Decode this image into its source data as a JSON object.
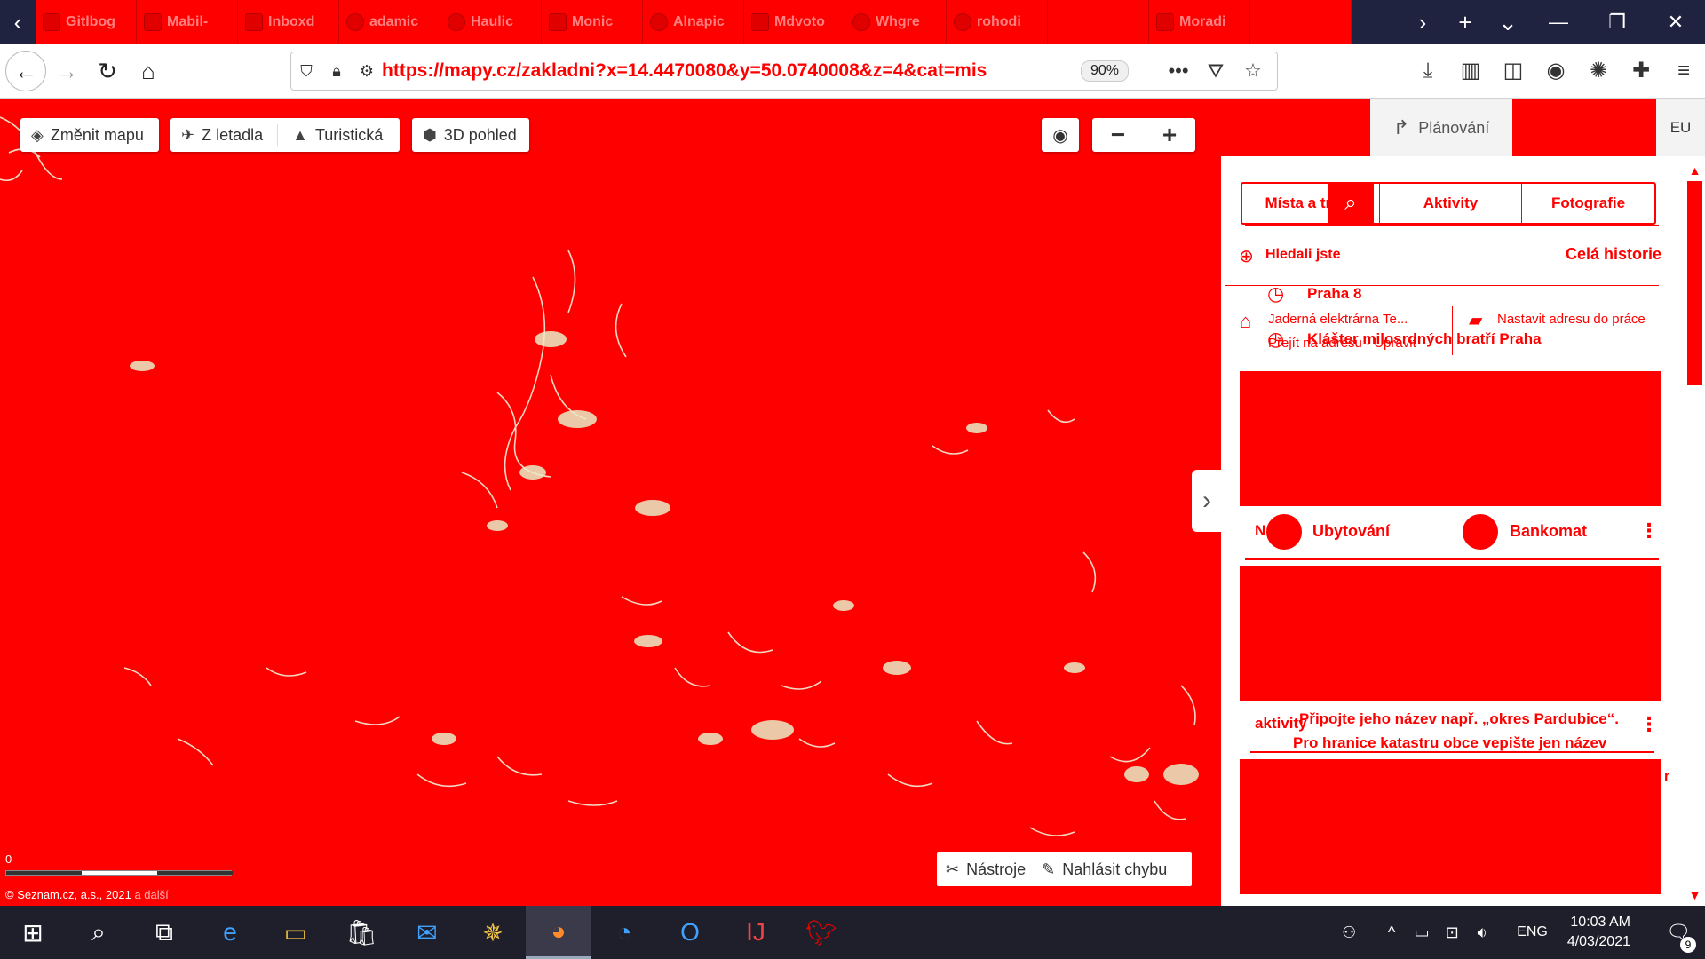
{
  "browser": {
    "tabs": [
      {
        "title": "Gitlbog",
        "favicon": "square"
      },
      {
        "title": "Mabil-",
        "favicon": "square"
      },
      {
        "title": "Inboxd",
        "favicon": "square"
      },
      {
        "title": "adamic",
        "favicon": "round"
      },
      {
        "title": "Haulic",
        "favicon": "round"
      },
      {
        "title": "Monic",
        "favicon": "square"
      },
      {
        "title": "Alnapic",
        "favicon": "round"
      },
      {
        "title": "Mdvoto",
        "favicon": "square"
      },
      {
        "title": "Whgre",
        "favicon": "round"
      },
      {
        "title": "rohodi",
        "favicon": "round"
      },
      {
        "title": "",
        "favicon": "none"
      },
      {
        "title": "Moradi",
        "favicon": "square"
      },
      {
        "title": "",
        "favicon": "none"
      }
    ],
    "url": "https://mapy.cz/zakladni?x=14.4470080&y=50.0740008&z=4&cat=mis",
    "zoom": "90%"
  },
  "map_toolbar": {
    "change_map": "Změnit mapu",
    "aerial": "Z letadla",
    "tourist": "Turistická",
    "view_3d": "3D pohled"
  },
  "map": {
    "tools": "Nástroje",
    "report_error": "Nahlásit chybu",
    "scale_label": "0",
    "copyright": "© Seznam.cz, a.s., 2021",
    "copyright_more": "a další"
  },
  "panel": {
    "planning": "Plánování",
    "language": "EU",
    "search_tabs": [
      "Místa a trasy",
      "Aktivity",
      "Fotografie"
    ],
    "history_left": "Hledali jste",
    "history_all": "Celá historie",
    "recent": [
      {
        "icon": "clock-icon",
        "label": "Praha 8"
      },
      {
        "icon": "clock-icon",
        "label": "Klášter milosrdných bratří Praha"
      }
    ],
    "home_label": "Jaderná elektrárna Te...",
    "home_actions": "Přejít na adresu · Upravit",
    "work_label": "Nastavit adresu do práce",
    "categories": [
      {
        "label": "Ubytování"
      },
      {
        "label": "Bankomat"
      }
    ],
    "card_prefix": "N",
    "activities_label": "aktivity",
    "hint_line1": "Připojte jeho název např. „okres Pardubice“.",
    "hint_line2": "Pro hranice katastru obce vepište jen název",
    "side_letter": "r"
  },
  "taskbar": {
    "apps": [
      "windows-start",
      "search",
      "task-view",
      "edge",
      "file-explorer",
      "store",
      "mail",
      "app-compass",
      "firefox",
      "app-blue-circle",
      "outlook",
      "intellij",
      "app-red-bird"
    ],
    "language": "ENG",
    "time": "10:03 AM",
    "date": "4/03/2021",
    "notifications": "9"
  }
}
